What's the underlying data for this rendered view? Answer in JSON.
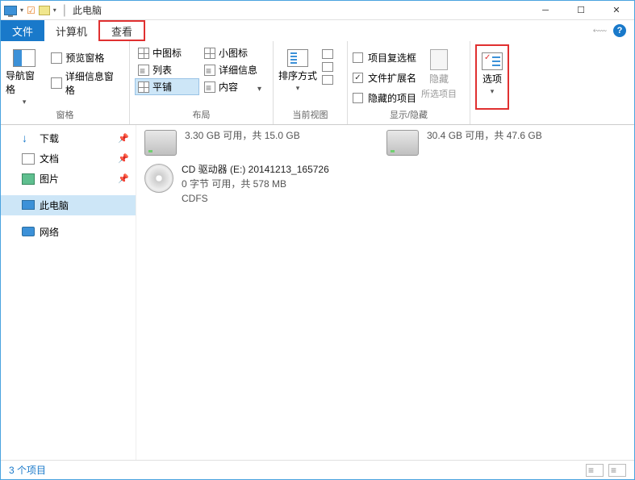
{
  "titlebar": {
    "title": "此电脑"
  },
  "tabs": {
    "file": "文件",
    "computer": "计算机",
    "view": "查看"
  },
  "ribbon": {
    "panes": {
      "nav_label": "导航窗格",
      "preview": "预览窗格",
      "details": "详细信息窗格",
      "group": "窗格"
    },
    "layout": {
      "medium": "中图标",
      "small": "小图标",
      "list": "列表",
      "details": "详细信息",
      "tiles": "平铺",
      "content": "内容",
      "group": "布局"
    },
    "currentview": {
      "sort": "排序方式",
      "group": "当前视图"
    },
    "showhide": {
      "checkboxes": "项目复选框",
      "extensions": "文件扩展名",
      "hidden": "隐藏的项目",
      "hide_btn": "隐藏",
      "hide_sub": "所选项目",
      "group": "显示/隐藏"
    },
    "options": {
      "label": "选项"
    }
  },
  "sidebar": {
    "downloads": "下载",
    "documents": "文档",
    "pictures": "图片",
    "thispc": "此电脑",
    "network": "网络"
  },
  "drives": {
    "d1_sub": "3.30 GB 可用，共 15.0 GB",
    "d2_sub": "30.4 GB 可用，共 47.6 GB",
    "cd_title": "CD 驱动器 (E:) 20141213_165726",
    "cd_sub": "0 字节 可用，共 578 MB",
    "cd_fs": "CDFS"
  },
  "status": {
    "count": "3 个项目"
  }
}
